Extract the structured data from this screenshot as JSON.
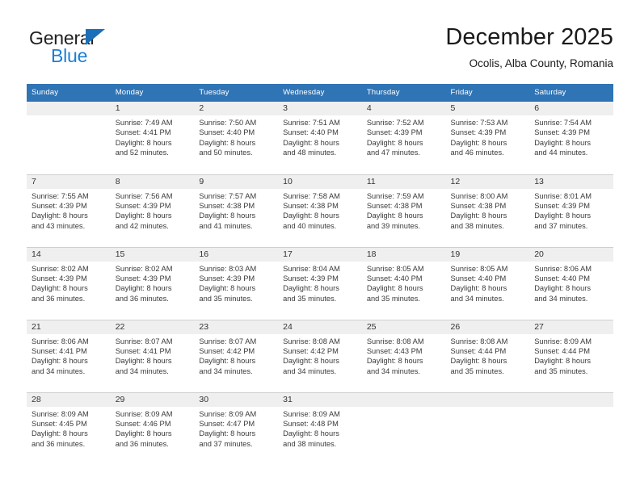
{
  "brand": {
    "name_top": "General",
    "name_bottom": "Blue",
    "accent_dark": "#1b6fb8",
    "accent_light": "#1b7fd4",
    "triangle_icon": "triangle-icon"
  },
  "header": {
    "title": "December 2025",
    "subtitle": "Ocolis, Alba County, Romania"
  },
  "theme": {
    "header_blue": "#2f74b5",
    "daynum_band": "#efefef",
    "grid_line": "#cfcfcf",
    "text": "#3a3a3a"
  },
  "weekdays": [
    "Sunday",
    "Monday",
    "Tuesday",
    "Wednesday",
    "Thursday",
    "Friday",
    "Saturday"
  ],
  "weeks": [
    [
      {
        "day": "",
        "blank": true,
        "sunrise": "",
        "sunset": "",
        "daylight1": "",
        "daylight2": ""
      },
      {
        "day": "1",
        "blank": false,
        "sunrise": "Sunrise: 7:49 AM",
        "sunset": "Sunset: 4:41 PM",
        "daylight1": "Daylight: 8 hours",
        "daylight2": "and 52 minutes."
      },
      {
        "day": "2",
        "blank": false,
        "sunrise": "Sunrise: 7:50 AM",
        "sunset": "Sunset: 4:40 PM",
        "daylight1": "Daylight: 8 hours",
        "daylight2": "and 50 minutes."
      },
      {
        "day": "3",
        "blank": false,
        "sunrise": "Sunrise: 7:51 AM",
        "sunset": "Sunset: 4:40 PM",
        "daylight1": "Daylight: 8 hours",
        "daylight2": "and 48 minutes."
      },
      {
        "day": "4",
        "blank": false,
        "sunrise": "Sunrise: 7:52 AM",
        "sunset": "Sunset: 4:39 PM",
        "daylight1": "Daylight: 8 hours",
        "daylight2": "and 47 minutes."
      },
      {
        "day": "5",
        "blank": false,
        "sunrise": "Sunrise: 7:53 AM",
        "sunset": "Sunset: 4:39 PM",
        "daylight1": "Daylight: 8 hours",
        "daylight2": "and 46 minutes."
      },
      {
        "day": "6",
        "blank": false,
        "sunrise": "Sunrise: 7:54 AM",
        "sunset": "Sunset: 4:39 PM",
        "daylight1": "Daylight: 8 hours",
        "daylight2": "and 44 minutes."
      }
    ],
    [
      {
        "day": "7",
        "blank": false,
        "sunrise": "Sunrise: 7:55 AM",
        "sunset": "Sunset: 4:39 PM",
        "daylight1": "Daylight: 8 hours",
        "daylight2": "and 43 minutes."
      },
      {
        "day": "8",
        "blank": false,
        "sunrise": "Sunrise: 7:56 AM",
        "sunset": "Sunset: 4:39 PM",
        "daylight1": "Daylight: 8 hours",
        "daylight2": "and 42 minutes."
      },
      {
        "day": "9",
        "blank": false,
        "sunrise": "Sunrise: 7:57 AM",
        "sunset": "Sunset: 4:38 PM",
        "daylight1": "Daylight: 8 hours",
        "daylight2": "and 41 minutes."
      },
      {
        "day": "10",
        "blank": false,
        "sunrise": "Sunrise: 7:58 AM",
        "sunset": "Sunset: 4:38 PM",
        "daylight1": "Daylight: 8 hours",
        "daylight2": "and 40 minutes."
      },
      {
        "day": "11",
        "blank": false,
        "sunrise": "Sunrise: 7:59 AM",
        "sunset": "Sunset: 4:38 PM",
        "daylight1": "Daylight: 8 hours",
        "daylight2": "and 39 minutes."
      },
      {
        "day": "12",
        "blank": false,
        "sunrise": "Sunrise: 8:00 AM",
        "sunset": "Sunset: 4:38 PM",
        "daylight1": "Daylight: 8 hours",
        "daylight2": "and 38 minutes."
      },
      {
        "day": "13",
        "blank": false,
        "sunrise": "Sunrise: 8:01 AM",
        "sunset": "Sunset: 4:39 PM",
        "daylight1": "Daylight: 8 hours",
        "daylight2": "and 37 minutes."
      }
    ],
    [
      {
        "day": "14",
        "blank": false,
        "sunrise": "Sunrise: 8:02 AM",
        "sunset": "Sunset: 4:39 PM",
        "daylight1": "Daylight: 8 hours",
        "daylight2": "and 36 minutes."
      },
      {
        "day": "15",
        "blank": false,
        "sunrise": "Sunrise: 8:02 AM",
        "sunset": "Sunset: 4:39 PM",
        "daylight1": "Daylight: 8 hours",
        "daylight2": "and 36 minutes."
      },
      {
        "day": "16",
        "blank": false,
        "sunrise": "Sunrise: 8:03 AM",
        "sunset": "Sunset: 4:39 PM",
        "daylight1": "Daylight: 8 hours",
        "daylight2": "and 35 minutes."
      },
      {
        "day": "17",
        "blank": false,
        "sunrise": "Sunrise: 8:04 AM",
        "sunset": "Sunset: 4:39 PM",
        "daylight1": "Daylight: 8 hours",
        "daylight2": "and 35 minutes."
      },
      {
        "day": "18",
        "blank": false,
        "sunrise": "Sunrise: 8:05 AM",
        "sunset": "Sunset: 4:40 PM",
        "daylight1": "Daylight: 8 hours",
        "daylight2": "and 35 minutes."
      },
      {
        "day": "19",
        "blank": false,
        "sunrise": "Sunrise: 8:05 AM",
        "sunset": "Sunset: 4:40 PM",
        "daylight1": "Daylight: 8 hours",
        "daylight2": "and 34 minutes."
      },
      {
        "day": "20",
        "blank": false,
        "sunrise": "Sunrise: 8:06 AM",
        "sunset": "Sunset: 4:40 PM",
        "daylight1": "Daylight: 8 hours",
        "daylight2": "and 34 minutes."
      }
    ],
    [
      {
        "day": "21",
        "blank": false,
        "sunrise": "Sunrise: 8:06 AM",
        "sunset": "Sunset: 4:41 PM",
        "daylight1": "Daylight: 8 hours",
        "daylight2": "and 34 minutes."
      },
      {
        "day": "22",
        "blank": false,
        "sunrise": "Sunrise: 8:07 AM",
        "sunset": "Sunset: 4:41 PM",
        "daylight1": "Daylight: 8 hours",
        "daylight2": "and 34 minutes."
      },
      {
        "day": "23",
        "blank": false,
        "sunrise": "Sunrise: 8:07 AM",
        "sunset": "Sunset: 4:42 PM",
        "daylight1": "Daylight: 8 hours",
        "daylight2": "and 34 minutes."
      },
      {
        "day": "24",
        "blank": false,
        "sunrise": "Sunrise: 8:08 AM",
        "sunset": "Sunset: 4:42 PM",
        "daylight1": "Daylight: 8 hours",
        "daylight2": "and 34 minutes."
      },
      {
        "day": "25",
        "blank": false,
        "sunrise": "Sunrise: 8:08 AM",
        "sunset": "Sunset: 4:43 PM",
        "daylight1": "Daylight: 8 hours",
        "daylight2": "and 34 minutes."
      },
      {
        "day": "26",
        "blank": false,
        "sunrise": "Sunrise: 8:08 AM",
        "sunset": "Sunset: 4:44 PM",
        "daylight1": "Daylight: 8 hours",
        "daylight2": "and 35 minutes."
      },
      {
        "day": "27",
        "blank": false,
        "sunrise": "Sunrise: 8:09 AM",
        "sunset": "Sunset: 4:44 PM",
        "daylight1": "Daylight: 8 hours",
        "daylight2": "and 35 minutes."
      }
    ],
    [
      {
        "day": "28",
        "blank": false,
        "sunrise": "Sunrise: 8:09 AM",
        "sunset": "Sunset: 4:45 PM",
        "daylight1": "Daylight: 8 hours",
        "daylight2": "and 36 minutes."
      },
      {
        "day": "29",
        "blank": false,
        "sunrise": "Sunrise: 8:09 AM",
        "sunset": "Sunset: 4:46 PM",
        "daylight1": "Daylight: 8 hours",
        "daylight2": "and 36 minutes."
      },
      {
        "day": "30",
        "blank": false,
        "sunrise": "Sunrise: 8:09 AM",
        "sunset": "Sunset: 4:47 PM",
        "daylight1": "Daylight: 8 hours",
        "daylight2": "and 37 minutes."
      },
      {
        "day": "31",
        "blank": false,
        "sunrise": "Sunrise: 8:09 AM",
        "sunset": "Sunset: 4:48 PM",
        "daylight1": "Daylight: 8 hours",
        "daylight2": "and 38 minutes."
      },
      {
        "day": "",
        "blank": true,
        "sunrise": "",
        "sunset": "",
        "daylight1": "",
        "daylight2": ""
      },
      {
        "day": "",
        "blank": true,
        "sunrise": "",
        "sunset": "",
        "daylight1": "",
        "daylight2": ""
      },
      {
        "day": "",
        "blank": true,
        "sunrise": "",
        "sunset": "",
        "daylight1": "",
        "daylight2": ""
      }
    ]
  ]
}
